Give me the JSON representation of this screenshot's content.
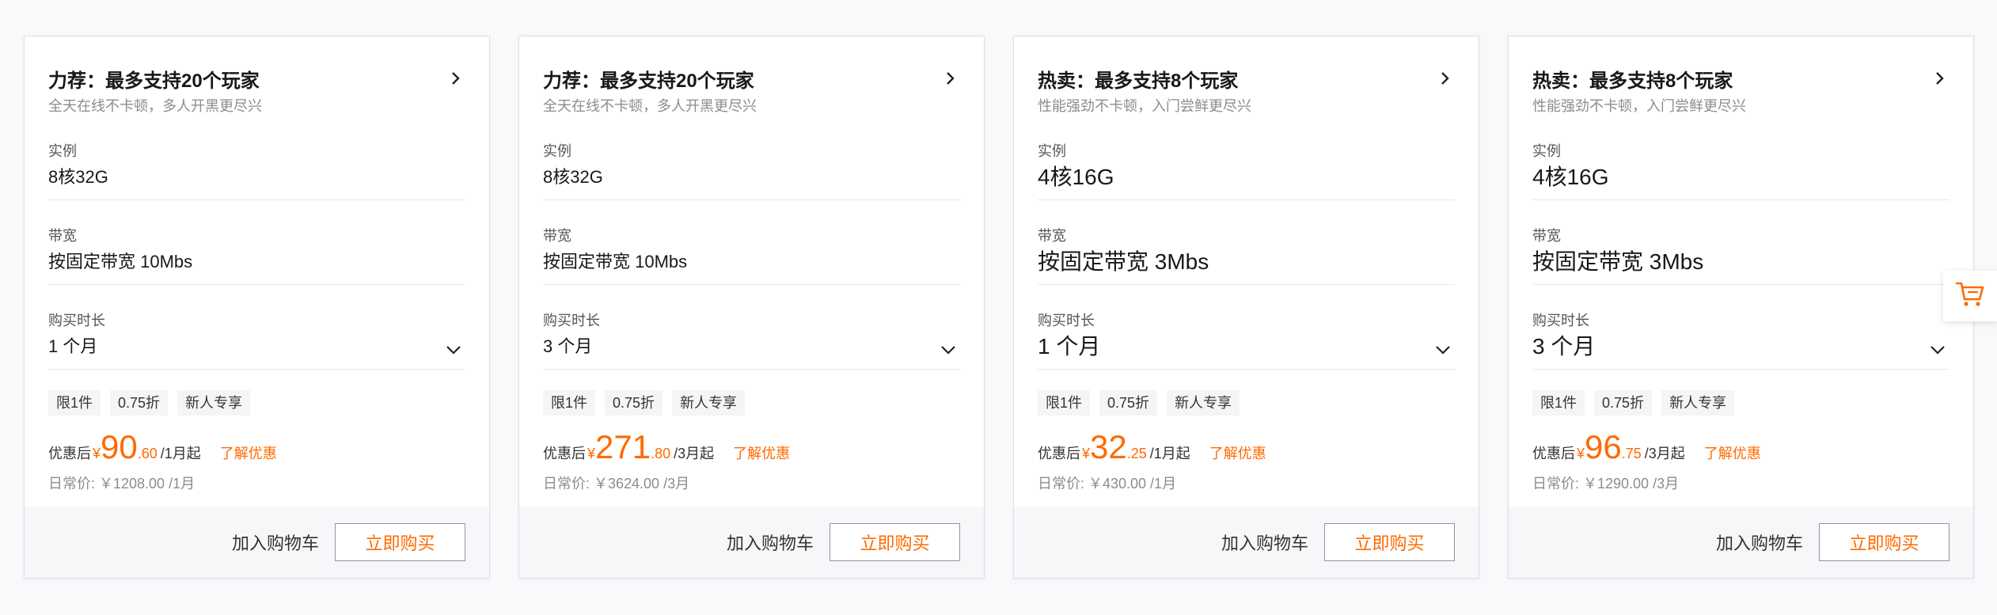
{
  "cards": [
    {
      "title": "力荐：最多支持20个玩家",
      "subtitle": "全天在线不卡顿，多人开黑更尽兴",
      "instance_label": "实例",
      "instance": "8核32G",
      "bandwidth_label": "带宽",
      "bandwidth": "按固定带宽 10Mbs",
      "duration_label": "购买时长",
      "duration": "1 个月",
      "tags": [
        "限1件",
        "0.75折",
        "新人专享"
      ],
      "price_prefix": "优惠后",
      "currency": "¥",
      "price_int": "90",
      "price_dec": ".60",
      "price_unit": "/1月起",
      "promo_link": "了解优惠",
      "original_price": "日常价: ￥1208.00 /1月",
      "add_cart": "加入购物车",
      "buy_now": "立即购买"
    },
    {
      "title": "力荐：最多支持20个玩家",
      "subtitle": "全天在线不卡顿，多人开黑更尽兴",
      "instance_label": "实例",
      "instance": "8核32G",
      "bandwidth_label": "带宽",
      "bandwidth": "按固定带宽 10Mbs",
      "duration_label": "购买时长",
      "duration": "3 个月",
      "tags": [
        "限1件",
        "0.75折",
        "新人专享"
      ],
      "price_prefix": "优惠后",
      "currency": "¥",
      "price_int": "271",
      "price_dec": ".80",
      "price_unit": "/3月起",
      "promo_link": "了解优惠",
      "original_price": "日常价: ￥3624.00 /3月",
      "add_cart": "加入购物车",
      "buy_now": "立即购买"
    },
    {
      "title": "热卖：最多支持8个玩家",
      "subtitle": "性能强劲不卡顿，入门尝鲜更尽兴",
      "instance_label": "实例",
      "instance": "4核16G",
      "bandwidth_label": "带宽",
      "bandwidth": "按固定带宽 3Mbs",
      "duration_label": "购买时长",
      "duration": "1 个月",
      "tags": [
        "限1件",
        "0.75折",
        "新人专享"
      ],
      "price_prefix": "优惠后",
      "currency": "¥",
      "price_int": "32",
      "price_dec": ".25",
      "price_unit": "/1月起",
      "promo_link": "了解优惠",
      "original_price": "日常价: ￥430.00 /1月",
      "add_cart": "加入购物车",
      "buy_now": "立即购买"
    },
    {
      "title": "热卖：最多支持8个玩家",
      "subtitle": "性能强劲不卡顿，入门尝鲜更尽兴",
      "instance_label": "实例",
      "instance": "4核16G",
      "bandwidth_label": "带宽",
      "bandwidth": "按固定带宽 3Mbs",
      "duration_label": "购买时长",
      "duration": "3 个月",
      "tags": [
        "限1件",
        "0.75折",
        "新人专享"
      ],
      "price_prefix": "优惠后",
      "currency": "¥",
      "price_int": "96",
      "price_dec": ".75",
      "price_unit": "/3月起",
      "promo_link": "了解优惠",
      "original_price": "日常价: ￥1290.00 /3月",
      "add_cart": "加入购物车",
      "buy_now": "立即购买"
    }
  ],
  "floating_cart_icon": "shopping-cart-icon",
  "colors": {
    "accent": "#ff6a00",
    "border": "#dcdfe6",
    "footer_bg": "#f7f7f9"
  }
}
